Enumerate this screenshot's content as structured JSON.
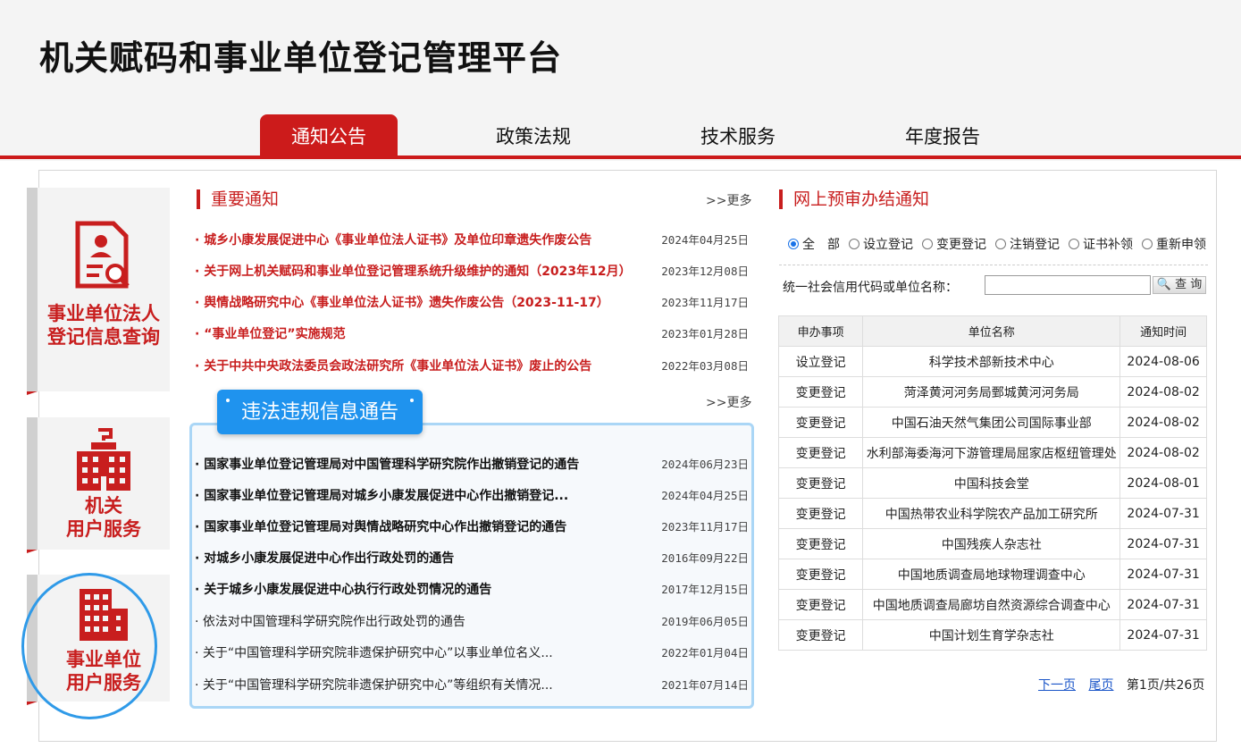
{
  "site_title": "机关赋码和事业单位登记管理平台",
  "nav": [
    {
      "label": "通知公告",
      "active": true
    },
    {
      "label": "政策法规",
      "active": false
    },
    {
      "label": "技术服务",
      "active": false
    },
    {
      "label": "年度报告",
      "active": false
    }
  ],
  "tiles": [
    {
      "label_line1": "事业单位法人",
      "label_line2": "登记信息查询",
      "icon": "certificate-search-icon"
    },
    {
      "label_line1": "机关",
      "label_line2": "用户服务",
      "icon": "government-building-icon"
    },
    {
      "label_line1": "事业单位",
      "label_line2": "用户服务",
      "icon": "office-building-icon"
    }
  ],
  "important": {
    "title": "重要通知",
    "more": ">>更多",
    "items": [
      {
        "title": "· 城乡小康发展促进中心《事业单位法人证书》及单位印章遗失作废公告",
        "date": "2024年04月25日"
      },
      {
        "title": "· 关于网上机关赋码和事业单位登记管理系统升级维护的通知（2023年12月）",
        "date": "2023年12月08日"
      },
      {
        "title": "· 舆情战略研究中心《事业单位法人证书》遗失作废公告（2023-11-17）",
        "date": "2023年11月17日"
      },
      {
        "title": "· “事业单位登记”实施规范",
        "date": "2023年01月28日"
      },
      {
        "title": "· 关于中共中央政法委员会政法研究所《事业单位法人证书》废止的公告",
        "date": "2022年03月08日"
      }
    ]
  },
  "violations": {
    "title": "违法违规信息通告",
    "more": ">>更多",
    "items": [
      {
        "title": "· 国家事业单位登记管理局对中国管理科学研究院作出撤销登记的通告",
        "date": "2024年06月23日",
        "style": "bold"
      },
      {
        "title": "· 国家事业单位登记管理局对城乡小康发展促进中心作出撤销登记...",
        "date": "2024年04月25日",
        "style": "bold"
      },
      {
        "title": "· 国家事业单位登记管理局对舆情战略研究中心作出撤销登记的通告",
        "date": "2023年11月17日",
        "style": "bold"
      },
      {
        "title": "· 对城乡小康发展促进中心作出行政处罚的通告",
        "date": "2016年09月22日",
        "style": "bold"
      },
      {
        "title": "· 关于城乡小康发展促进中心执行行政处罚情况的通告",
        "date": "2017年12月15日",
        "style": "bold"
      },
      {
        "title": "· 依法对中国管理科学研究院作出行政处罚的通告",
        "date": "2019年06月05日",
        "style": "plain"
      },
      {
        "title": "· 关于“中国管理科学研究院非遗保护研究中心”以事业单位名义...",
        "date": "2022年01月04日",
        "style": "plain"
      },
      {
        "title": "· 关于“中国管理科学研究院非遗保护研究中心”等组织有关情况...",
        "date": "2021年07月14日",
        "style": "plain"
      }
    ]
  },
  "pretrial": {
    "title": "网上预审办结通知",
    "filters": [
      {
        "label": "全　部",
        "checked": true
      },
      {
        "label": "设立登记",
        "checked": false
      },
      {
        "label": "变更登记",
        "checked": false
      },
      {
        "label": "注销登记",
        "checked": false
      },
      {
        "label": "证书补领",
        "checked": false
      },
      {
        "label": "重新申领",
        "checked": false
      }
    ],
    "search_label": "统一社会信用代码或单位名称：",
    "search_value": "",
    "search_button": "查 询",
    "columns": [
      "申办事项",
      "单位名称",
      "通知时间"
    ],
    "rows": [
      [
        "设立登记",
        "科学技术部新技术中心",
        "2024-08-06"
      ],
      [
        "变更登记",
        "菏泽黄河河务局鄄城黄河河务局",
        "2024-08-02"
      ],
      [
        "变更登记",
        "中国石油天然气集团公司国际事业部",
        "2024-08-02"
      ],
      [
        "变更登记",
        "水利部海委海河下游管理局屈家店枢纽管理处",
        "2024-08-02"
      ],
      [
        "变更登记",
        "中国科技会堂",
        "2024-08-01"
      ],
      [
        "变更登记",
        "中国热带农业科学院农产品加工研究所",
        "2024-07-31"
      ],
      [
        "变更登记",
        "中国残疾人杂志社",
        "2024-07-31"
      ],
      [
        "变更登记",
        "中国地质调查局地球物理调查中心",
        "2024-07-31"
      ],
      [
        "变更登记",
        "中国地质调查局廊坊自然资源综合调查中心",
        "2024-07-31"
      ],
      [
        "变更登记",
        "中国计划生育学杂志社",
        "2024-07-31"
      ]
    ],
    "pager": {
      "next": "下一页",
      "last": "尾页",
      "info": "第1页/共26页"
    }
  },
  "colors": {
    "brand_red": "#cc1b1b",
    "accent_blue": "#1f93ee"
  }
}
